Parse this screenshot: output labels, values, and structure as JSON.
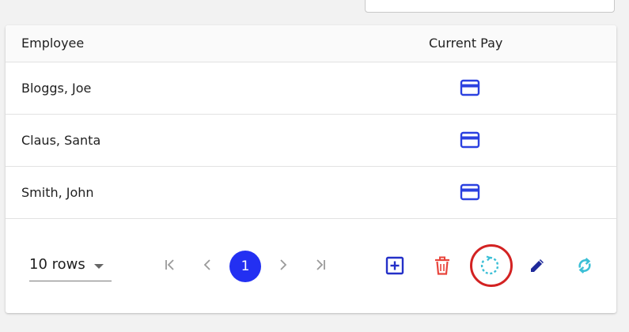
{
  "table": {
    "headers": {
      "employee": "Employee",
      "current_pay": "Current Pay"
    },
    "rows": [
      {
        "employee": "Bloggs, Joe",
        "pay_icon": "credit-card-icon"
      },
      {
        "employee": "Claus, Santa",
        "pay_icon": "credit-card-icon"
      },
      {
        "employee": "Smith, John",
        "pay_icon": "credit-card-icon"
      }
    ]
  },
  "pagination": {
    "rows_per_page": "10 rows",
    "current_page": "1",
    "icons": [
      "first-page-icon",
      "previous-page-icon",
      "next-page-icon",
      "last-page-icon"
    ]
  },
  "actions": {
    "icons": [
      "add-icon",
      "delete-icon",
      "reset-icon",
      "edit-icon",
      "sync-icon"
    ],
    "highlighted": "reset-icon"
  },
  "colors": {
    "accent_blue": "#2330f2",
    "card_icon_blue": "#2b41e0",
    "add_blue": "#2430c8",
    "delete_red": "#e8453c",
    "reset_cyan": "#3bbfd6",
    "edit_navy": "#1f2a9a",
    "highlight_ring_red": "#d32222",
    "pager_gray": "#9a9a9a"
  }
}
